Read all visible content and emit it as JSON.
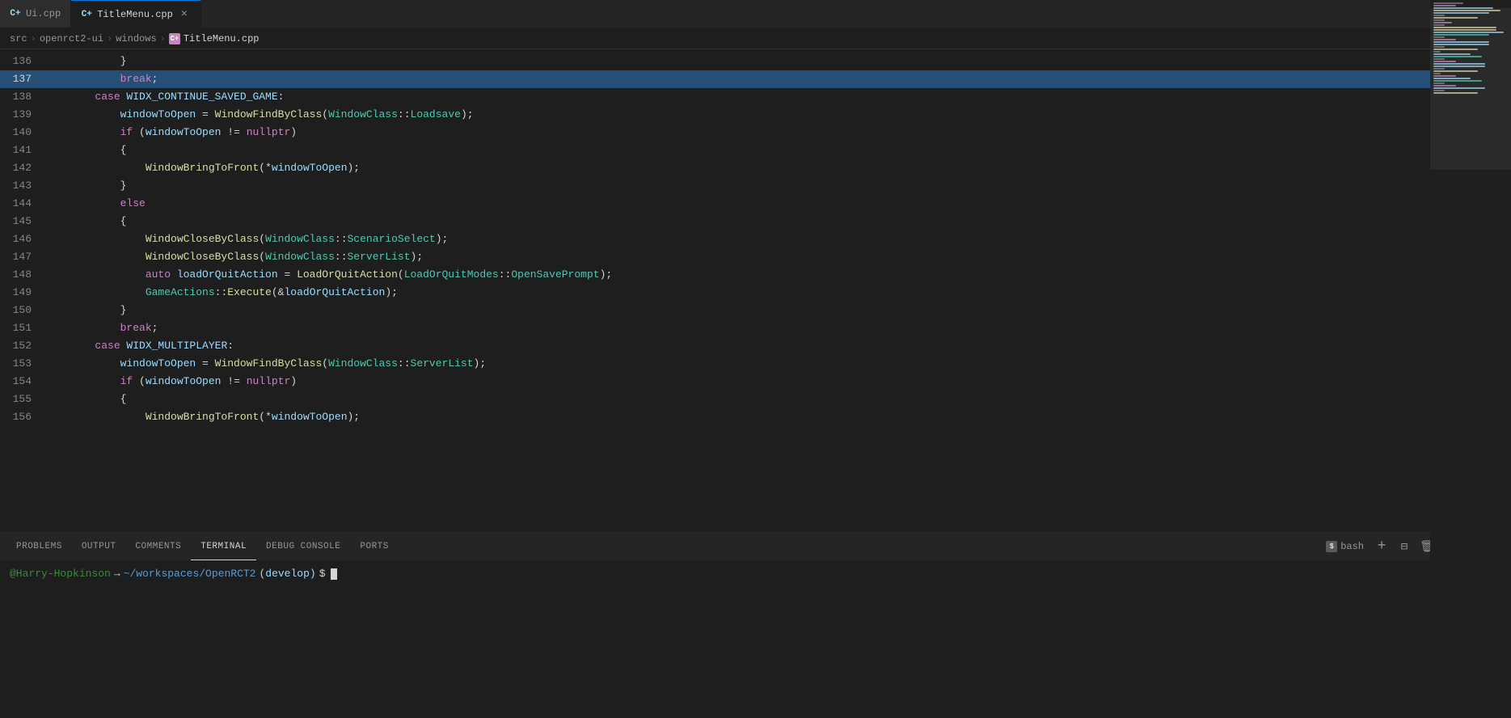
{
  "tabs": [
    {
      "id": "ui-cpp",
      "label": "Ui.cpp",
      "icon": "C++-icon",
      "active": false,
      "modified": false
    },
    {
      "id": "titlemenu-cpp",
      "label": "TitleMenu.cpp",
      "icon": "C++-icon",
      "active": true,
      "modified": false
    }
  ],
  "breadcrumb": {
    "items": [
      "src",
      "openrct2-ui",
      "windows",
      "TitleMenu.cpp"
    ],
    "file_icon": "C++"
  },
  "code": {
    "lines": [
      {
        "num": 136,
        "content": "            }",
        "highlighted": false
      },
      {
        "num": 137,
        "content": "            break;",
        "highlighted": true
      },
      {
        "num": 138,
        "content": "        case WIDX_CONTINUE_SAVED_GAME:",
        "highlighted": false
      },
      {
        "num": 139,
        "content": "            windowToOpen = WindowFindByClass(WindowClass::Loadsave);",
        "highlighted": false
      },
      {
        "num": 140,
        "content": "            if (windowToOpen != nullptr)",
        "highlighted": false
      },
      {
        "num": 141,
        "content": "            {",
        "highlighted": false
      },
      {
        "num": 142,
        "content": "                WindowBringToFront(*windowToOpen);",
        "highlighted": false
      },
      {
        "num": 143,
        "content": "            }",
        "highlighted": false
      },
      {
        "num": 144,
        "content": "            else",
        "highlighted": false
      },
      {
        "num": 145,
        "content": "            {",
        "highlighted": false
      },
      {
        "num": 146,
        "content": "                WindowCloseByClass(WindowClass::ScenarioSelect);",
        "highlighted": false
      },
      {
        "num": 147,
        "content": "                WindowCloseByClass(WindowClass::ServerList);",
        "highlighted": false
      },
      {
        "num": 148,
        "content": "                auto loadOrQuitAction = LoadOrQuitAction(LoadOrQuitModes::OpenSavePrompt);",
        "highlighted": false
      },
      {
        "num": 149,
        "content": "                GameActions::Execute(&loadOrQuitAction);",
        "highlighted": false
      },
      {
        "num": 150,
        "content": "            }",
        "highlighted": false
      },
      {
        "num": 151,
        "content": "            break;",
        "highlighted": false
      },
      {
        "num": 152,
        "content": "        case WIDX_MULTIPLAYER:",
        "highlighted": false
      },
      {
        "num": 153,
        "content": "            windowToOpen = WindowFindByClass(WindowClass::ServerList);",
        "highlighted": false
      },
      {
        "num": 154,
        "content": "            if (windowToOpen != nullptr)",
        "highlighted": false
      },
      {
        "num": 155,
        "content": "            {",
        "highlighted": false
      },
      {
        "num": 156,
        "content": "                WindowBringToFront(*windowToOpen);",
        "highlighted": false
      }
    ]
  },
  "panel": {
    "tabs": [
      "PROBLEMS",
      "OUTPUT",
      "COMMENTS",
      "TERMINAL",
      "DEBUG CONSOLE",
      "PORTS"
    ],
    "active_tab": "TERMINAL",
    "terminal": {
      "user": "@Harry-Hopkinson",
      "arrow": "→",
      "path": "~/workspaces/OpenRCT2",
      "branch": "(develop)",
      "prompt": "$"
    }
  },
  "toolbar": {
    "split_editor": "⊞",
    "more_actions": "…"
  },
  "panel_actions": {
    "bash_label": "bash",
    "add": "+",
    "split": "⊟",
    "trash": "🗑",
    "more": "…",
    "collapse": "∧",
    "close": "✕"
  }
}
